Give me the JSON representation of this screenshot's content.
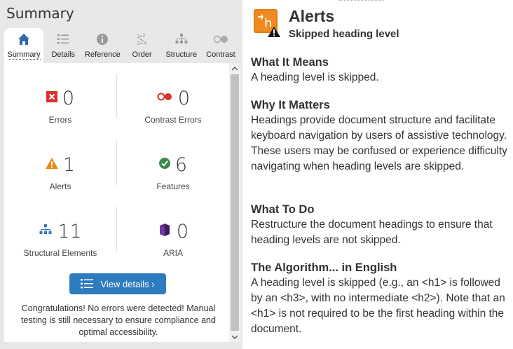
{
  "left": {
    "title": "Summary",
    "tabs": [
      {
        "label": "Summary",
        "icon": "home-icon",
        "active": true
      },
      {
        "label": "Details",
        "icon": "list-icon",
        "active": false
      },
      {
        "label": "Reference",
        "icon": "info-icon",
        "active": false
      },
      {
        "label": "Order",
        "icon": "order-icon",
        "active": false
      },
      {
        "label": "Structure",
        "icon": "structure-icon",
        "active": false
      },
      {
        "label": "Contrast",
        "icon": "contrast-icon",
        "active": false
      }
    ],
    "stats": {
      "errors": {
        "count": "0",
        "label": "Errors"
      },
      "contrast_errors": {
        "count": "0",
        "label": "Contrast Errors"
      },
      "alerts": {
        "count": "1",
        "label": "Alerts"
      },
      "features": {
        "count": "6",
        "label": "Features"
      },
      "structural": {
        "count": "11",
        "label": "Structural Elements"
      },
      "aria": {
        "count": "0",
        "label": "ARIA"
      }
    },
    "view_details_label": "View details ›",
    "congrats_text": "Congratulations! No errors were detected! Manual testing is still necessary to ensure compliance and optimal accessibility."
  },
  "right": {
    "title": "Alerts",
    "subtitle": "Skipped heading level",
    "sections": [
      {
        "heading": "What It Means",
        "body": "A heading level is skipped."
      },
      {
        "heading": "Why It Matters",
        "body": "Headings provide document structure and facilitate keyboard navigation by users of assistive technology. These users may be confused or experience difficulty navigating when heading levels are skipped."
      },
      {
        "heading": "What To Do",
        "body": "Restructure the document headings to ensure that heading levels are not skipped."
      },
      {
        "heading": "The Algorithm... in English",
        "body": "A heading level is skipped (e.g., an <h1> is followed by an <h3>, with no intermediate <h2>). Note that an <h1> is not required to be the first heading within the document."
      }
    ]
  },
  "colors": {
    "accent_blue": "#2f7bbf",
    "error_red": "#d9302c",
    "alert_orange": "#e98a16",
    "feature_green": "#3a8a4c",
    "aria_purple": "#5b2a86",
    "structure_blue": "#3a74c4"
  }
}
